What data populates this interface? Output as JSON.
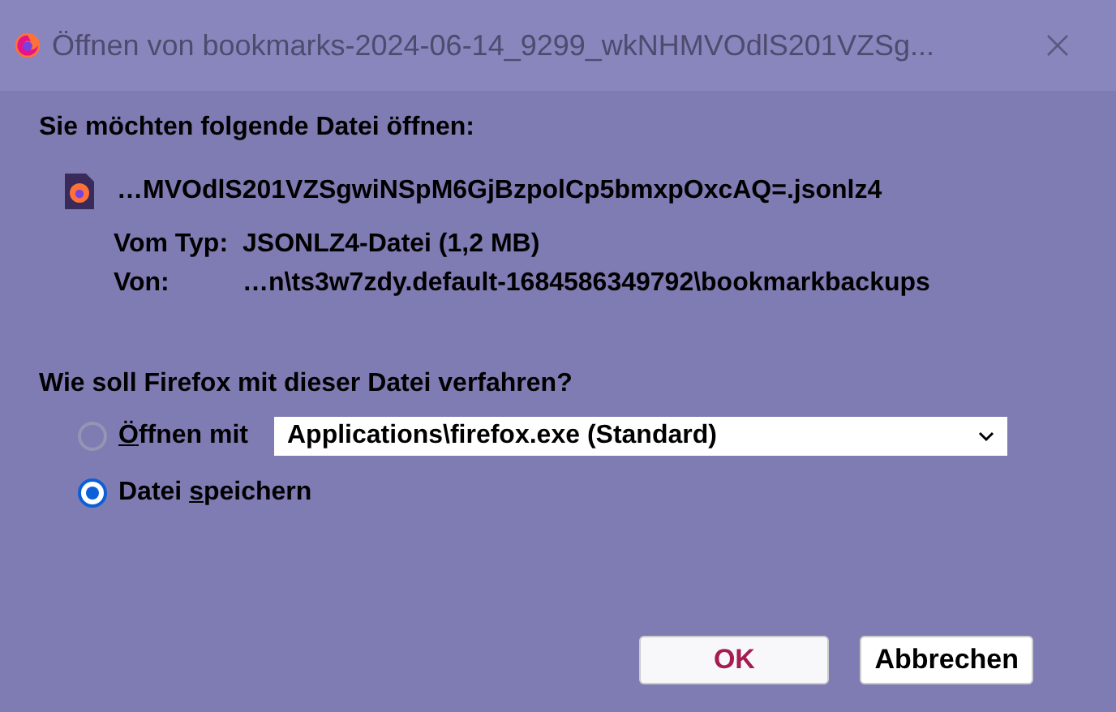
{
  "window": {
    "title": "Öffnen von bookmarks-2024-06-14_9299_wkNHMVOdlS201VZSg..."
  },
  "heading": "Sie möchten folgende Datei öffnen:",
  "file": {
    "name": "…MVOdlS201VZSgwiNSpM6GjBzpolCp5bmxpOxcAQ=.jsonlz4",
    "type_label": "Vom Typ:",
    "type": "JSONLZ4-Datei (1,2 MB)",
    "from_label": "Von:",
    "from": "…n\\ts3w7zdy.default-1684586349792\\bookmarkbackups"
  },
  "question": "Wie soll Firefox mit dieser Datei verfahren?",
  "options": [
    {
      "key": "Ö",
      "after": "ffnen mit",
      "selected": false,
      "disabled": true,
      "dropdown": "Applications\\firefox.exe (Standard)"
    },
    {
      "before": "Datei ",
      "key": "s",
      "after": "peichern",
      "selected": true,
      "disabled": false
    }
  ],
  "buttons": [
    {
      "label": "OK",
      "default": true
    },
    {
      "label": "Abbrechen",
      "default": false
    }
  ]
}
